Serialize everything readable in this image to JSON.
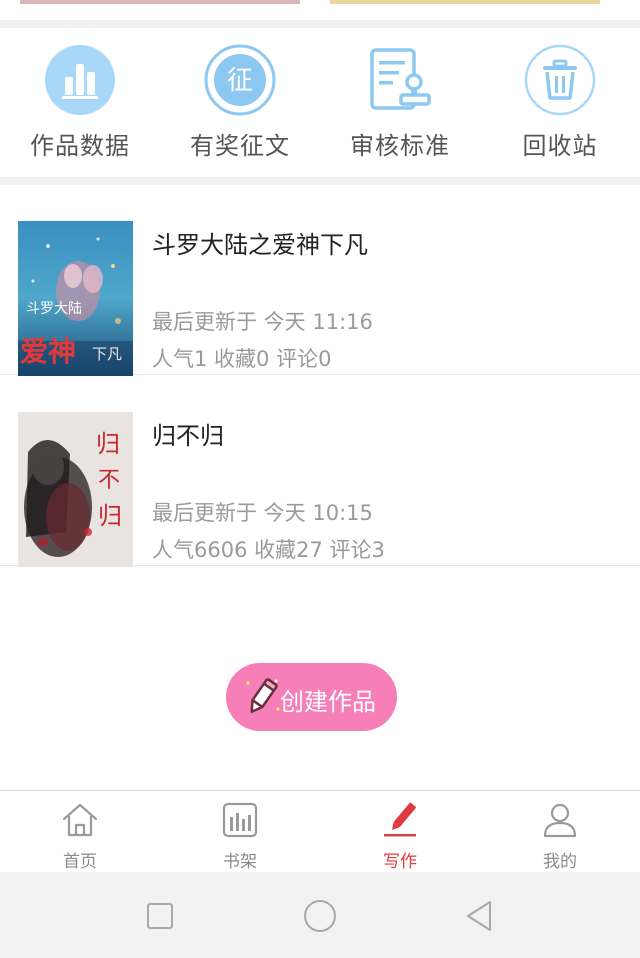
{
  "tools": [
    {
      "label": "作品数据",
      "icon": "bar-chart-icon"
    },
    {
      "label": "有奖征文",
      "icon": "contest-icon",
      "glyph": "征"
    },
    {
      "label": "审核标准",
      "icon": "review-standard-icon"
    },
    {
      "label": "回收站",
      "icon": "trash-icon"
    }
  ],
  "works": [
    {
      "title": "斗罗大陆之爱神下凡",
      "updated": "最后更新于 今天 11:16",
      "stats": "人气1 收藏0 评论0",
      "cover_text": [
        "斗罗大陆",
        "爱神",
        "下凡"
      ]
    },
    {
      "title": "归不归",
      "updated": "最后更新于 今天 10:15",
      "stats": "人气6606 收藏27 评论3",
      "cover_text": [
        "归",
        "不",
        "归"
      ]
    }
  ],
  "create_button": {
    "label": "创建作品",
    "icon": "pencil-icon"
  },
  "tabbar": [
    {
      "label": "首页",
      "icon": "home-icon",
      "active": false
    },
    {
      "label": "书架",
      "icon": "bookshelf-icon",
      "active": false
    },
    {
      "label": "写作",
      "icon": "write-icon",
      "active": true
    },
    {
      "label": "我的",
      "icon": "user-icon",
      "active": false
    }
  ],
  "system_nav": [
    "square-icon",
    "circle-icon",
    "back-triangle-icon"
  ],
  "colors": {
    "accent": "#e0393e",
    "icon_blue": "#8cc8f0",
    "create_button": "#f77fb8",
    "muted_text": "#9a9a9a"
  }
}
